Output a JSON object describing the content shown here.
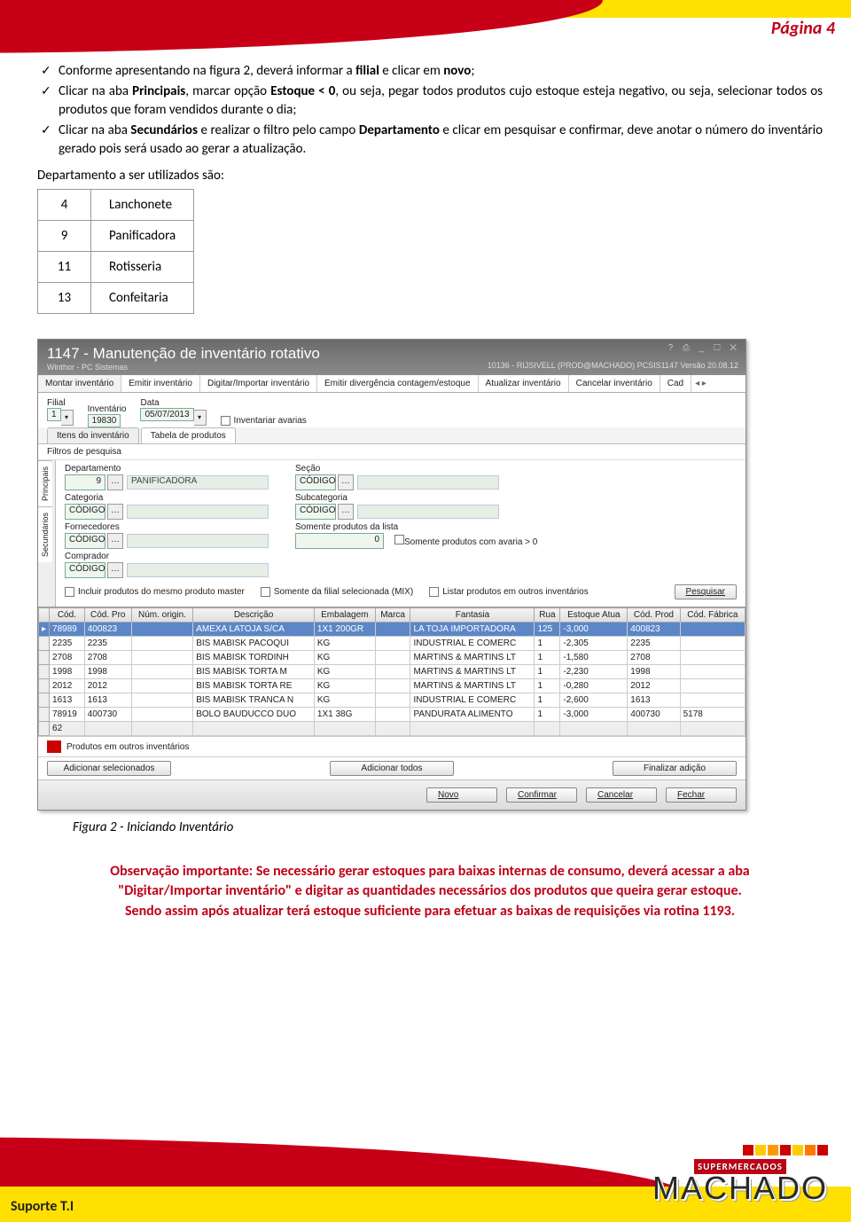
{
  "page_tag": "Página 4",
  "bullets": [
    {
      "pre": "Conforme apresentando na figura 2, deverá informar a ",
      "b1": "filial",
      "mid": " e clicar em ",
      "b2": "novo",
      "post": ";"
    },
    {
      "pre": "Clicar na aba ",
      "b1": "Principais",
      "mid": ", marcar opção ",
      "b2": "Estoque < 0",
      "post": ", ou seja, pegar todos produtos cujo estoque esteja negativo, ou seja, selecionar todos os produtos que foram vendidos durante o dia;"
    },
    {
      "pre": "Clicar na aba ",
      "b1": "Secundários",
      "mid": " e realizar o filtro pelo campo ",
      "b2": "Departamento",
      "post": " e clicar em pesquisar e confirmar, deve anotar o número do inventário gerado pois será usado ao gerar a atualização."
    }
  ],
  "dep_header": "Departamento a ser utilizados são:",
  "departments": [
    {
      "id": "4",
      "name": "Lanchonete"
    },
    {
      "id": "9",
      "name": "Panificadora"
    },
    {
      "id": "11",
      "name": "Rotisseria"
    },
    {
      "id": "13",
      "name": "Confeitaria"
    }
  ],
  "app": {
    "title": "1147 - Manutenção de inventário rotativo",
    "subtitle": "Winthor - PC Sistemas",
    "rinfo": "10136 - RIJSIVELL (PROD@MACHADO)   PCSIS1147   Versão 20.08.12",
    "winbtns": "?  ⎙  _  ☐  ✕",
    "tabs": [
      "Montar inventário",
      "Emitir inventário",
      "Digitar/Importar inventário",
      "Emitir divergência contagem/estoque",
      "Atualizar inventário",
      "Cancelar inventário",
      "Cad"
    ],
    "active_tab": 0,
    "filial_label": "Filial",
    "filial_value": "1",
    "inventario_label": "Inventário",
    "inventario_value": "19830",
    "data_label": "Data",
    "data_value": "05/07/2013",
    "chk_avarias": "Inventariar avarias",
    "subtabs": [
      "Itens do inventário",
      "Tabela de produtos"
    ],
    "subtab_active": 1,
    "vtabs": [
      "Principais",
      "Secundários"
    ],
    "filters_title": "Filtros de pesquisa",
    "departamento_label": "Departamento",
    "departamento_value": "9",
    "departamento_desc": "PANIFICADORA",
    "secao_label": "Seção",
    "secao_value": "CÓDIGO",
    "categoria_label": "Categoria",
    "categoria_value": "CÓDIGO",
    "subcategoria_label": "Subcategoria",
    "subcategoria_value": "CÓDIGO",
    "fornecedores_label": "Fornecedores",
    "fornecedores_value": "CÓDIGO",
    "somente_lista_label": "Somente produtos da lista",
    "somente_lista_value": "0",
    "chk_avaria0": "Somente produtos com avaria > 0",
    "comprador_label": "Comprador",
    "comprador_value": "CÓDIGO",
    "chk_master": "Incluir produtos do mesmo produto master",
    "chk_mix": "Somente da filial selecionada (MIX)",
    "chk_listar": "Listar produtos em outros inventários",
    "btn_pesquisar": "Pesquisar",
    "columns": [
      "",
      "Cód.",
      "Cód. Pro",
      "Núm. origin.",
      "Descrição",
      "Embalagem",
      "Marca",
      "Fantasia",
      "Rua",
      "Estoque Atua",
      "Cód. Prod",
      "Cód. Fábrica"
    ],
    "rows": [
      [
        "▸",
        "78989",
        "400823",
        "",
        "AMEXA LATOJA S/CA",
        "1X1 200GR",
        "",
        "LA TOJA IMPORTADORA",
        "125",
        "-3,000",
        "400823",
        ""
      ],
      [
        "",
        "2235",
        "2235",
        "",
        "BIS MABISK PACOQUI",
        "KG",
        "",
        "INDUSTRIAL E COMERC",
        "1",
        "-2,305",
        "2235",
        ""
      ],
      [
        "",
        "2708",
        "2708",
        "",
        "BIS MABISK TORDINH",
        "KG",
        "",
        "MARTINS & MARTINS LT",
        "1",
        "-1,580",
        "2708",
        ""
      ],
      [
        "",
        "1998",
        "1998",
        "",
        "BIS MABISK TORTA M",
        "KG",
        "",
        "MARTINS & MARTINS LT",
        "1",
        "-2,230",
        "1998",
        ""
      ],
      [
        "",
        "2012",
        "2012",
        "",
        "BIS MABISK TORTA RE",
        "KG",
        "",
        "MARTINS & MARTINS LT",
        "1",
        "-0,280",
        "2012",
        ""
      ],
      [
        "",
        "1613",
        "1613",
        "",
        "BIS MABISK TRANCA N",
        "KG",
        "",
        "INDUSTRIAL E COMERC",
        "1",
        "-2,600",
        "1613",
        ""
      ],
      [
        "",
        "78919",
        "400730",
        "",
        "BOLO BAUDUCCO DUO",
        "1X1 38G",
        "",
        "PANDURATA ALIMENTO",
        "1",
        "-3,000",
        "400730",
        "5178"
      ]
    ],
    "foot_count": "62",
    "red_label": "Produtos em outros inventários",
    "btn_add_sel": "Adicionar selecionados",
    "btn_add_all": "Adicionar todos",
    "btn_finalizar": "Finalizar adição",
    "btn_novo": "Novo",
    "btn_confirmar": "Confirmar",
    "btn_cancelar": "Cancelar",
    "btn_fechar": "Fechar"
  },
  "caption": "Figura 2 - Iniciando Inventário",
  "obs": {
    "l1a": "Observação importante: ",
    "l1b": "Se necessário gerar estoques para baixas internas de consumo, deverá acessar a aba",
    "l2a": "\"Digitar/Importar inventário\"",
    "l2b": " e digitar as quantidades necessários dos produtos que queira gerar estoque.",
    "l3": "Sendo assim após atualizar terá estoque suficiente para efetuar as baixas de requisições via rotina 1193."
  },
  "logo_super": "SUPERMERCADOS",
  "logo_name": "MACHADO",
  "footer": "Suporte T.I"
}
